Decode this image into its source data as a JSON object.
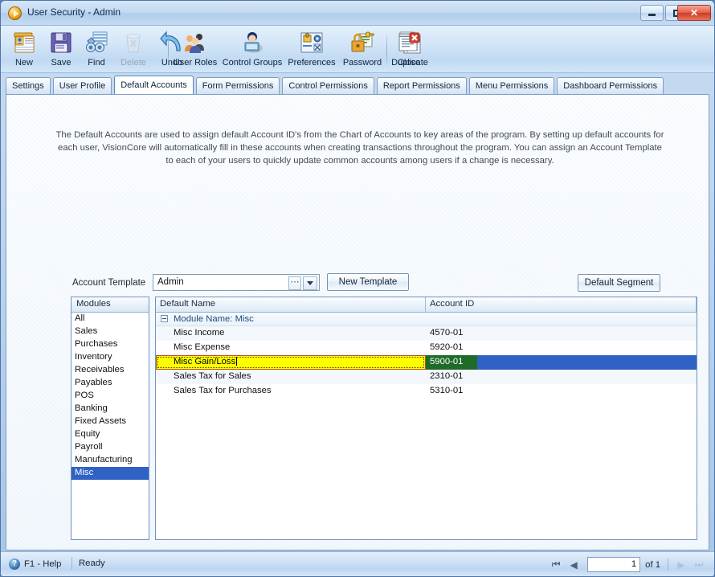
{
  "window": {
    "title": "User Security - Admin",
    "icon": "play-circle-icon",
    "controls": {
      "minimize": "minimize-icon",
      "maximize": "maximize-icon",
      "close": "✕"
    }
  },
  "toolbar": {
    "items": [
      {
        "label": "New",
        "icon": "new-record-icon",
        "disabled": false
      },
      {
        "label": "Save",
        "icon": "floppy-disk-icon",
        "disabled": false
      },
      {
        "label": "Find",
        "icon": "binoculars-icon",
        "disabled": false
      },
      {
        "label": "Delete",
        "icon": "trash-can-icon",
        "disabled": true
      },
      {
        "label": "Undo",
        "icon": "undo-arrow-icon",
        "disabled": false
      },
      {
        "label": "User Roles",
        "icon": "users-group-icon",
        "disabled": false
      },
      {
        "label": "Control Groups",
        "icon": "user-computer-icon",
        "disabled": false
      },
      {
        "label": "Preferences",
        "icon": "lock-settings-icon",
        "disabled": false
      },
      {
        "label": "Password",
        "icon": "padlock-key-icon",
        "disabled": false
      },
      {
        "label": "Duplicate",
        "icon": "copy-pages-icon",
        "disabled": false
      },
      {
        "label": "Close",
        "icon": "close-document-icon",
        "disabled": false
      }
    ]
  },
  "tabs": [
    {
      "label": "Settings",
      "active": false
    },
    {
      "label": "User Profile",
      "active": false
    },
    {
      "label": "Default Accounts",
      "active": true
    },
    {
      "label": "Form Permissions",
      "active": false
    },
    {
      "label": "Control Permissions",
      "active": false
    },
    {
      "label": "Report Permissions",
      "active": false
    },
    {
      "label": "Menu Permissions",
      "active": false
    },
    {
      "label": "Dashboard Permissions",
      "active": false
    }
  ],
  "main": {
    "description": "The Default Accounts are used to assign default Account ID's from the Chart of Accounts to key areas of the program.  By setting up default accounts for each user, VisionCore will automatically fill in these accounts when creating transactions throughout the program.  You can assign an Account Template to each of your users to quickly update common accounts among users if a change is necessary.",
    "account_template_label": "Account Template",
    "account_template_value": "Admin",
    "account_template_placeholder": "Admin",
    "ellipsis_label": "⋯",
    "new_template_button": "New Template",
    "default_segment_button": "Default Segment"
  },
  "modules": {
    "header": "Modules",
    "items": [
      {
        "label": "All",
        "selected": false
      },
      {
        "label": "Sales",
        "selected": false
      },
      {
        "label": "Purchases",
        "selected": false
      },
      {
        "label": "Inventory",
        "selected": false
      },
      {
        "label": "Receivables",
        "selected": false
      },
      {
        "label": "Payables",
        "selected": false
      },
      {
        "label": "POS",
        "selected": false
      },
      {
        "label": "Banking",
        "selected": false
      },
      {
        "label": "Fixed Assets",
        "selected": false
      },
      {
        "label": "Equity",
        "selected": false
      },
      {
        "label": "Payroll",
        "selected": false
      },
      {
        "label": "Manufacturing",
        "selected": false
      },
      {
        "label": "Misc",
        "selected": true
      }
    ]
  },
  "grid": {
    "columns": [
      "Default Name",
      "Account ID"
    ],
    "group_row": "Module Name: Misc",
    "rows": [
      {
        "name": "Misc Income",
        "account": "4570-01",
        "selected": false,
        "editing": false
      },
      {
        "name": "Misc Expense",
        "account": "5920-01",
        "selected": false,
        "editing": false
      },
      {
        "name": "Misc Gain/Loss",
        "account": "5900-01",
        "selected": true,
        "editing": true
      },
      {
        "name": "Sales Tax for Sales",
        "account": "2310-01",
        "selected": false,
        "editing": false
      },
      {
        "name": "Sales Tax for Purchases",
        "account": "5310-01",
        "selected": false,
        "editing": false
      }
    ]
  },
  "statusbar": {
    "help": "F1 - Help",
    "help_icon": "question-mark-icon",
    "status": "Ready",
    "pager": {
      "first": "⏮",
      "prev": "◀",
      "next": "▶",
      "last": "⏭",
      "page": "1",
      "of_label": "of 1"
    }
  },
  "colors": {
    "selection_blue": "#2f62c4",
    "edit_yellow": "#ffff00",
    "account_green": "#1f6b2a",
    "close_red": "#cc3c26"
  }
}
